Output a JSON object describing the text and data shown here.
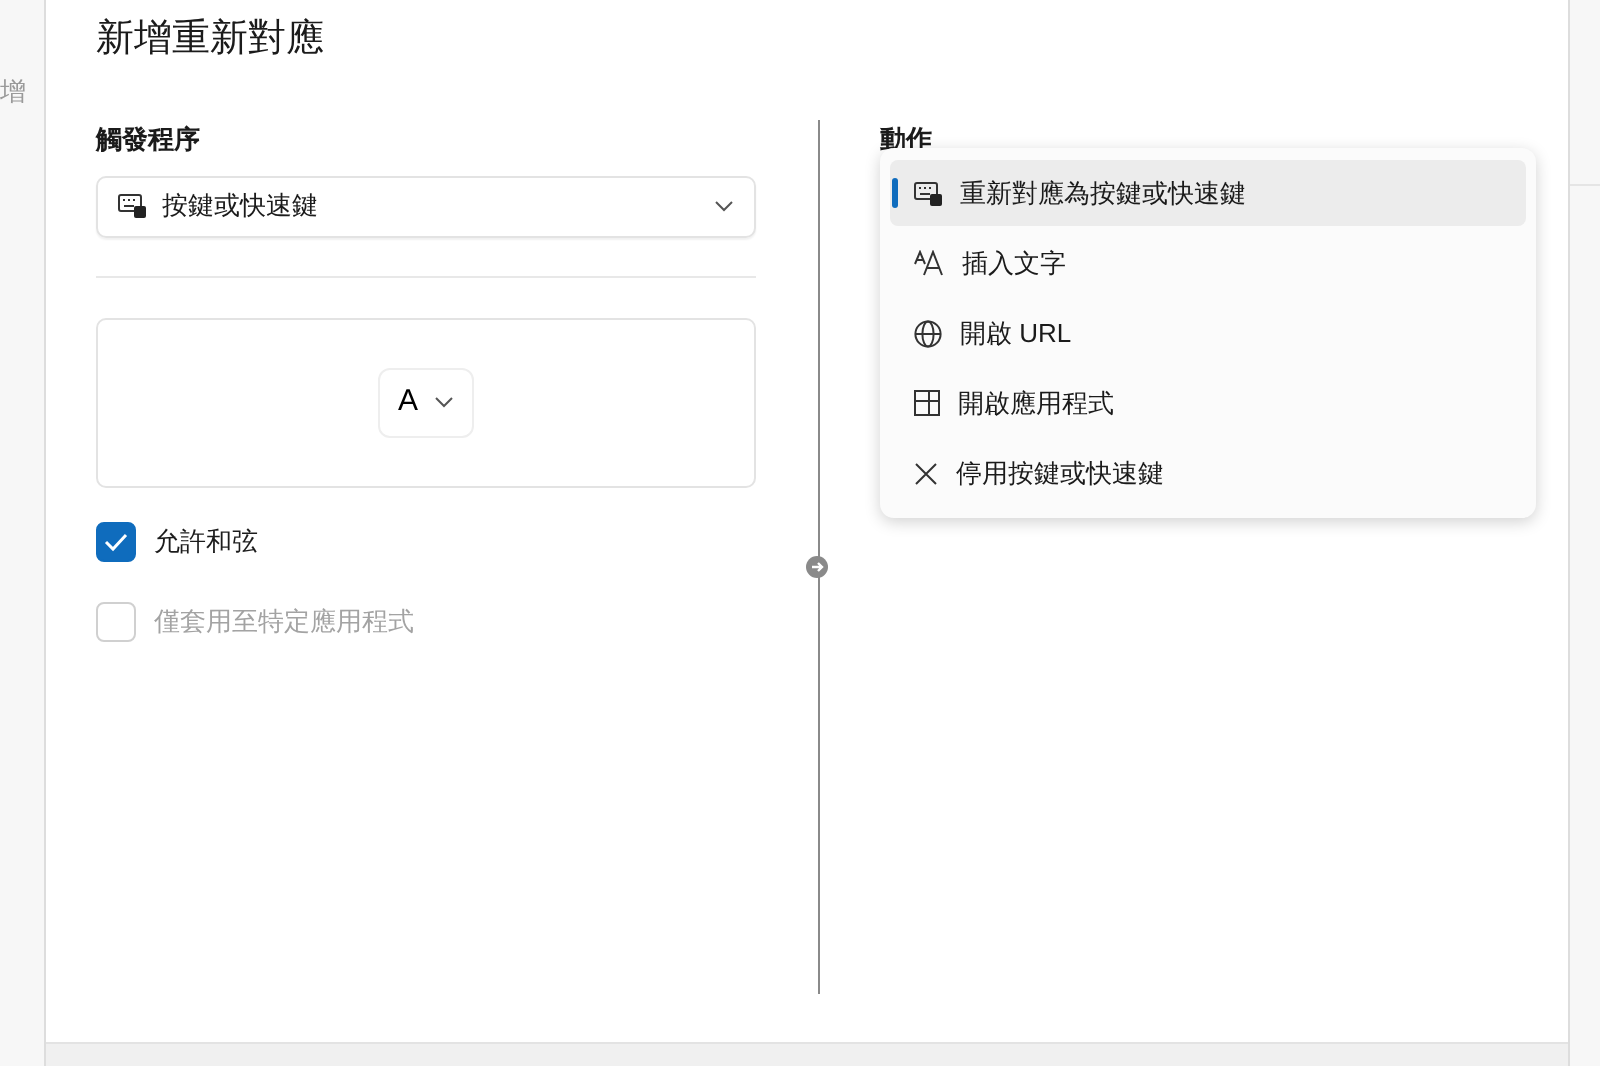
{
  "background": {
    "fragment": "增"
  },
  "dialog": {
    "title": "新增重新對應",
    "trigger": {
      "heading": "觸發程序",
      "select_value": "按鍵或快速鍵",
      "key_value": "A",
      "options": [
        {
          "label": "允許和弦",
          "checked": true,
          "disabled": false
        },
        {
          "label": "僅套用至特定應用程式",
          "checked": false,
          "disabled": true
        }
      ]
    },
    "action": {
      "heading": "動作",
      "menu": [
        {
          "label": "重新對應為按鍵或快速鍵",
          "kind": "keyboard",
          "selected": true
        },
        {
          "label": "插入文字",
          "kind": "text",
          "selected": false
        },
        {
          "label": "開啟 URL",
          "kind": "globe",
          "selected": false
        },
        {
          "label": "開啟應用程式",
          "kind": "app",
          "selected": false
        },
        {
          "label": "停用按鍵或快速鍵",
          "kind": "disable",
          "selected": false
        }
      ]
    }
  }
}
